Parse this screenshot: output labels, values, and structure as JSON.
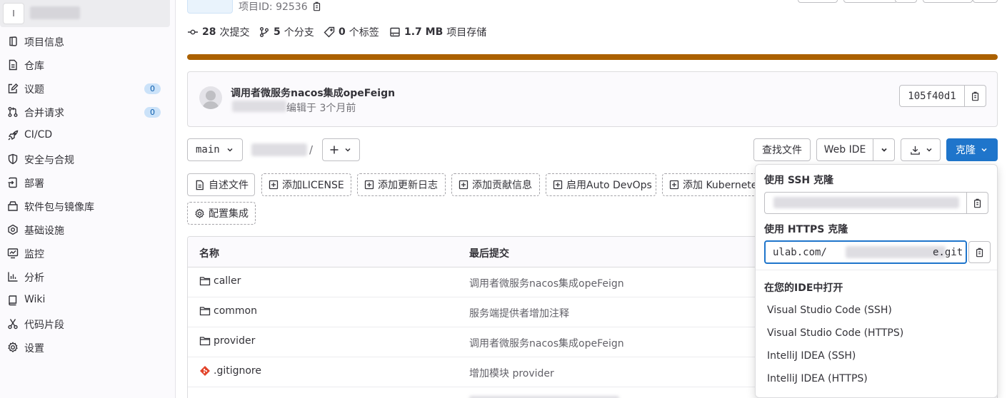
{
  "sidebar": {
    "avatar_letter": "I",
    "items": [
      {
        "label": "项目信息",
        "icon": "project-info-icon"
      },
      {
        "label": "仓库",
        "icon": "document-icon"
      },
      {
        "label": "议题",
        "icon": "issues-icon",
        "badge": "0"
      },
      {
        "label": "合并请求",
        "icon": "merge-request-icon",
        "badge": "0"
      },
      {
        "label": "CI/CD",
        "icon": "rocket-icon"
      },
      {
        "label": "安全与合规",
        "icon": "shield-icon"
      },
      {
        "label": "部署",
        "icon": "deployments-icon"
      },
      {
        "label": "软件包与镜像库",
        "icon": "package-icon"
      },
      {
        "label": "基础设施",
        "icon": "cloud-gear-icon"
      },
      {
        "label": "监控",
        "icon": "monitor-icon"
      },
      {
        "label": "分析",
        "icon": "chart-icon"
      },
      {
        "label": "Wiki",
        "icon": "book-icon"
      },
      {
        "label": "代码片段",
        "icon": "snippet-icon"
      },
      {
        "label": "设置",
        "icon": "gear-icon"
      }
    ]
  },
  "project": {
    "id_label": "项目ID: 92536"
  },
  "stats": {
    "commits_count": "28",
    "commits_label": "次提交",
    "branches_count": "5",
    "branches_label": "个分支",
    "tags_count": "0",
    "tags_label": "个标签",
    "storage_size": "1.7 MB",
    "storage_label": "项目存储"
  },
  "colors": {
    "progress": "#ab6100",
    "clone_button": "#1f75cb",
    "badge_bg": "#cbe2f9"
  },
  "commit": {
    "title": "调用者微服务nacos集成opeFeign",
    "meta": "编辑于 3个月前",
    "sha": "105f40d1"
  },
  "toolbar": {
    "branch": "main",
    "path_sep": "/",
    "find_file": "查找文件",
    "web_ide": "Web IDE",
    "clone": "克隆"
  },
  "quick_actions": [
    {
      "label": "自述文件",
      "style": "solid",
      "icon": "document-icon"
    },
    {
      "label": "添加LICENSE",
      "style": "dashed",
      "icon": "plus-square-icon"
    },
    {
      "label": "添加更新日志",
      "style": "dashed",
      "icon": "plus-square-icon"
    },
    {
      "label": "添加贡献信息",
      "style": "dashed",
      "icon": "plus-square-icon"
    },
    {
      "label": "启用Auto DevOps",
      "style": "dashed",
      "icon": "plus-square-icon"
    },
    {
      "label": "添加 Kubernetes",
      "style": "dashed",
      "icon": "plus-square-icon"
    },
    {
      "label": "配置集成",
      "style": "dashed",
      "icon": "gear-icon"
    }
  ],
  "table": {
    "col_name": "名称",
    "col_last_commit": "最后提交",
    "rows": [
      {
        "name": "caller",
        "type": "folder",
        "commit": "调用者微服务nacos集成opeFeign"
      },
      {
        "name": "common",
        "type": "folder",
        "commit": "服务端提供者增加注释"
      },
      {
        "name": "provider",
        "type": "folder",
        "commit": "调用者微服务nacos集成opeFeign"
      },
      {
        "name": ".gitignore",
        "type": "git",
        "commit": "增加模块 provider"
      }
    ]
  },
  "clone_dropdown": {
    "ssh_label": "使用 SSH 克隆",
    "https_label": "使用 HTTPS 克隆",
    "https_value_start": "ulab.com/",
    "https_value_end": "e.git",
    "ide_header": "在您的IDE中打开",
    "ide_options": [
      "Visual Studio Code (SSH)",
      "Visual Studio Code (HTTPS)",
      "IntelliJ IDEA (SSH)",
      "IntelliJ IDEA (HTTPS)"
    ]
  }
}
